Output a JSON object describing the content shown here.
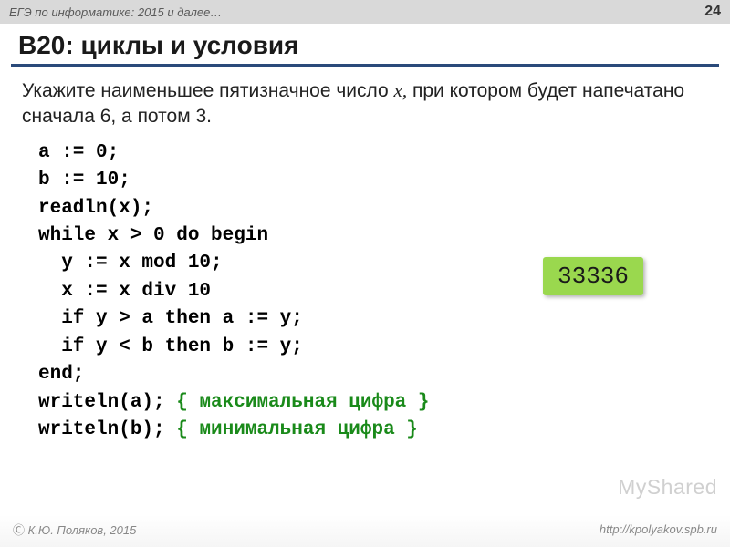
{
  "header": {
    "course": "ЕГЭ по информатике: 2015 и далее…",
    "page": "24"
  },
  "title": "B20: циклы и условия",
  "question": {
    "part1": "Укажите наименьшее пятизначное число ",
    "var": "x,",
    "part2": " при котором будет напечатано сначала 6, а потом 3."
  },
  "code": {
    "l1": "a := 0;",
    "l2": "b := 10;",
    "l3": "readln(x);",
    "l4": "while x > 0 do begin",
    "l5": "  y := x mod 10;",
    "l6": "  x := x div 10",
    "l7": "  if y > a then a := y;",
    "l8": "  if y < b then b := y;",
    "l9": "end;",
    "l10a": "writeln(a); ",
    "l10c": "{ максимальная цифра }",
    "l11a": "writeln(b); ",
    "l11c": "{ минимальная цифра }"
  },
  "answer": "33336",
  "watermark": "MyShared",
  "footer": {
    "author": "К.Ю. Поляков, 2015",
    "url": "http://kpolyakov.spb.ru"
  }
}
